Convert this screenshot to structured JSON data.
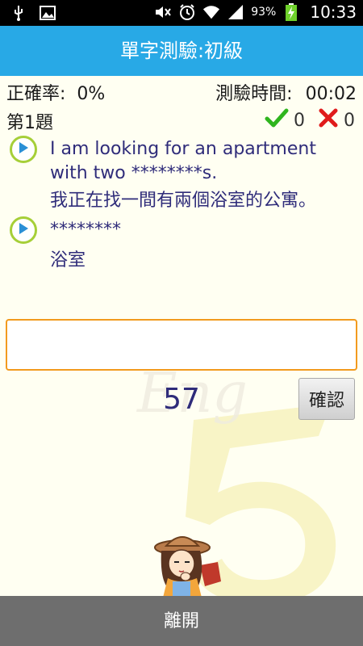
{
  "status_bar": {
    "battery_percent": "93%",
    "time": "10:33",
    "icons": [
      "usb-icon",
      "image-icon",
      "mute-icon",
      "alarm-icon",
      "wifi-icon",
      "signal-icon",
      "battery-charging-icon"
    ]
  },
  "title": "單字測驗:初級",
  "stats": {
    "accuracy_label": "正確率:",
    "accuracy_value": "0%",
    "time_label": "測驗時間:",
    "time_value": "00:02"
  },
  "question": {
    "number_label": "第1題",
    "correct_count": "0",
    "wrong_count": "0",
    "sentence_en": "I am looking for an apartment with two ********s.",
    "sentence_zh": "我正在找一間有兩個浴室的公寓。",
    "word_masked": "********",
    "word_zh": "浴室"
  },
  "answer_input": {
    "value": "",
    "placeholder": ""
  },
  "countdown": "57",
  "confirm_label": "確認",
  "exit_label": "離開",
  "colors": {
    "title_bar": "#28a9e6",
    "text_blue": "#2f2c7a",
    "input_border": "#f29a1e",
    "play_ring": "#a6cf38",
    "play_triangle": "#2a8fd6",
    "check_green": "#2fb51e",
    "cross_red": "#e01b1b",
    "bottom_bar": "#6e6e6e"
  }
}
